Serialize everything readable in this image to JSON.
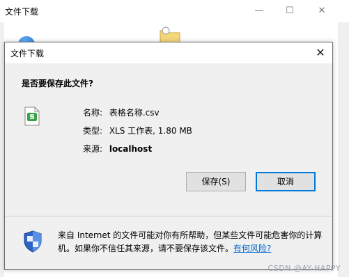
{
  "background_window": {
    "title": "文件下载",
    "minimize_glyph": "—",
    "maximize_glyph": "☐",
    "close_glyph": "✕"
  },
  "dialog": {
    "title": "文件下载",
    "close_glyph": "✕",
    "question": "是否要保存此文件?",
    "fields": {
      "name_label": "名称:",
      "name_value": "表格名称.csv",
      "type_label": "类型:",
      "type_value": "XLS 工作表, 1.80 MB",
      "source_label": "来源:",
      "source_value": "localhost"
    },
    "buttons": {
      "save": "保存(S)",
      "cancel": "取消"
    },
    "warning": {
      "text": "来自 Internet 的文件可能对你有所帮助，但某些文件可能危害你的计算机。如果你不信任其来源，请不要保存该文件。",
      "link": "有何风险?"
    }
  },
  "watermark": "CSDN @AY-HAPPY",
  "icons": {
    "file": "csv-file-icon",
    "shield": "security-shield-icon",
    "globe": "globe-icon",
    "folder": "folder-icon"
  },
  "colors": {
    "accent": "#0078d7",
    "link": "#0066cc",
    "file_icon_green": "#3aa24a"
  }
}
